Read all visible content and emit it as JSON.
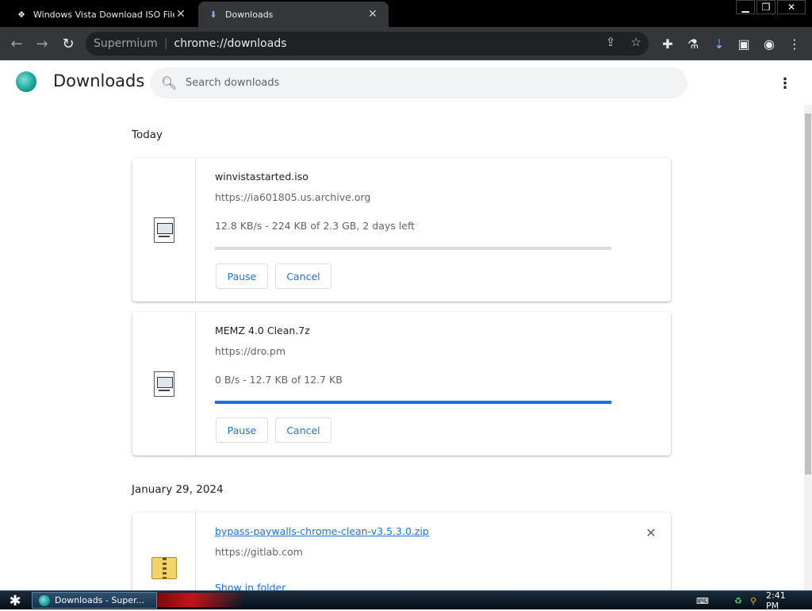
{
  "browser": {
    "tabs": [
      {
        "title": "Windows Vista Download ISO File F",
        "icon": "vista-icon",
        "active": false
      },
      {
        "title": "Downloads",
        "icon": "download-icon",
        "active": true
      }
    ],
    "omnibox": {
      "brand": "Supermium",
      "url": "chrome://downloads"
    }
  },
  "downloads_page": {
    "title": "Downloads",
    "search_placeholder": "Search downloads",
    "groups": [
      {
        "date": "Today",
        "items": [
          {
            "filename": "winvistastarted.iso",
            "source": "https://ia601805.us.archive.org",
            "status": "12.8 KB/s - 224 KB of 2.3 GB, 2 days left",
            "progress": 0.0001,
            "buttons": [
              "Pause",
              "Cancel"
            ],
            "icon": "file-icon"
          },
          {
            "filename": "MEMZ 4.0 Clean.7z",
            "source": "https://dro.pm",
            "status": "0 B/s - 12.7 KB of 12.7 KB",
            "progress": 1.0,
            "buttons": [
              "Pause",
              "Cancel"
            ],
            "icon": "file-icon"
          }
        ]
      },
      {
        "date": "January 29, 2024",
        "items": [
          {
            "filename": "bypass-paywalls-chrome-clean-v3.5.3.0.zip",
            "source": "https://gitlab.com",
            "action": "Show in folder",
            "icon": "zip-icon"
          }
        ]
      }
    ]
  },
  "taskbar": {
    "task_label": "Downloads - Super...",
    "clock": "2:41 PM"
  },
  "colors": {
    "accent": "#1a73e8",
    "toolbar": "#35363a",
    "omnibox": "#202124"
  }
}
